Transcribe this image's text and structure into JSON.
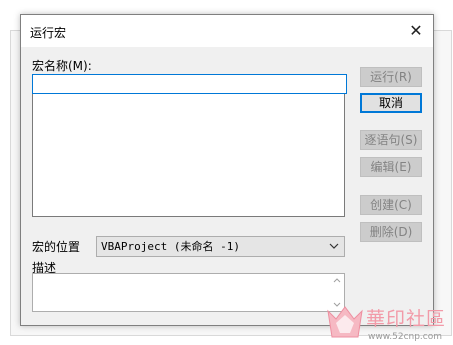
{
  "dialog": {
    "title": "运行宏",
    "macro_name_label": "宏名称(M):",
    "macro_name_value": "",
    "macro_list_items": [],
    "location_label": "宏的位置",
    "location_value": "VBAProject (未命名 -1)",
    "description_label": "描述",
    "description_value": ""
  },
  "buttons": {
    "run": "运行(R)",
    "cancel": "取消",
    "step_into": "逐语句(S)",
    "edit": "编辑(E)",
    "create": "创建(C)",
    "delete": "删除(D)"
  },
  "watermark": {
    "title": "華印社區",
    "url": "www.52cnp.com"
  },
  "colors": {
    "accent": "#0078d7",
    "dialog_bg": "#f0f0f0",
    "disabled_button_bg": "#cccccc",
    "disabled_text": "#838383",
    "watermark_pink": "#f29aa8"
  }
}
